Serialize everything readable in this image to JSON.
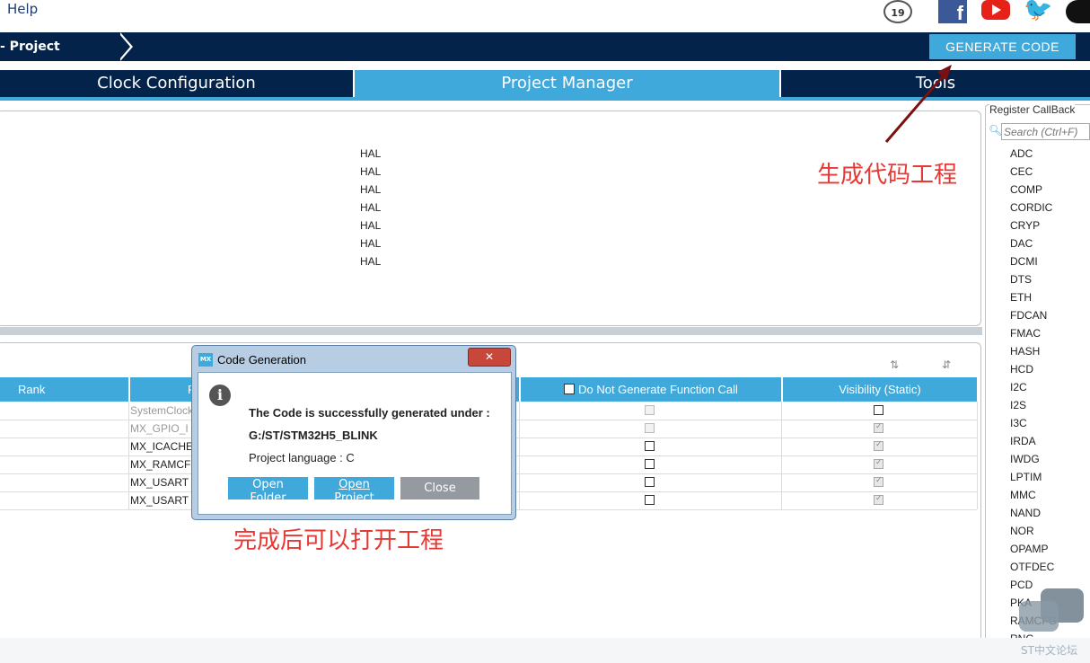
{
  "top_menu": {
    "help": "Help"
  },
  "social": {
    "badge": "19",
    "facebook": "f",
    "twitter": "🐦"
  },
  "breadcrumb": {
    "label": "- Project Manager"
  },
  "toolbar": {
    "generate_code": "GENERATE CODE"
  },
  "tabs": [
    {
      "label": "Clock Configuration"
    },
    {
      "label": "Project Manager"
    },
    {
      "label": "Tools"
    }
  ],
  "hal_items": [
    "HAL",
    "HAL",
    "HAL",
    "HAL",
    "HAL",
    "HAL",
    "HAL"
  ],
  "table": {
    "headers": {
      "rank": "Rank",
      "function": "F",
      "no_gen": "Do Not Generate Function Call",
      "visibility": "Visibility (Static)"
    },
    "rows": [
      {
        "fn": "SystemClock",
        "no_gen_disabled": true,
        "no_gen": false,
        "vis": false,
        "vis_enabled": true
      },
      {
        "fn": "MX_GPIO_I",
        "no_gen_disabled": true,
        "no_gen": false,
        "vis": true,
        "vis_enabled": false
      },
      {
        "fn": "MX_ICACHE",
        "no_gen_disabled": false,
        "no_gen": false,
        "vis": true,
        "vis_enabled": false
      },
      {
        "fn": "MX_RAMCF",
        "no_gen_disabled": false,
        "no_gen": false,
        "vis": true,
        "vis_enabled": false
      },
      {
        "fn": "MX_USART",
        "no_gen_disabled": false,
        "no_gen": false,
        "vis": true,
        "vis_enabled": false
      },
      {
        "fn": "MX_USART",
        "no_gen_disabled": false,
        "no_gen": false,
        "vis": true,
        "vis_enabled": false
      }
    ]
  },
  "register_callback": {
    "title": "Register CallBack",
    "search_placeholder": "Search (Ctrl+F)",
    "items": [
      "ADC",
      "CEC",
      "COMP",
      "CORDIC",
      "CRYP",
      "DAC",
      "DCMI",
      "DTS",
      "ETH",
      "FDCAN",
      "FMAC",
      "HASH",
      "HCD",
      "I2C",
      "I2S",
      "I3C",
      "IRDA",
      "IWDG",
      "LPTIM",
      "MMC",
      "NAND",
      "NOR",
      "OPAMP",
      "OTFDEC",
      "PCD",
      "PKA",
      "RAMCFG",
      "RNG"
    ]
  },
  "dialog": {
    "title": "Code Generation",
    "close_glyph": "✕",
    "icon_label": "MX",
    "info_glyph": "i",
    "message_line1": "The Code is successfully generated under :",
    "message_line2": "G:/ST/STM32H5_BLINK",
    "message_line3": "Project language : C",
    "open_folder": "Open Folder",
    "open_project": "Open Project",
    "close": "Close"
  },
  "annotations": {
    "generate": "生成代码工程",
    "open": "完成后可以打开工程"
  },
  "watermark": "ST中文论坛",
  "colors": {
    "navy": "#03234b",
    "accent": "#3fa9dc",
    "annotation": "#e53935"
  }
}
